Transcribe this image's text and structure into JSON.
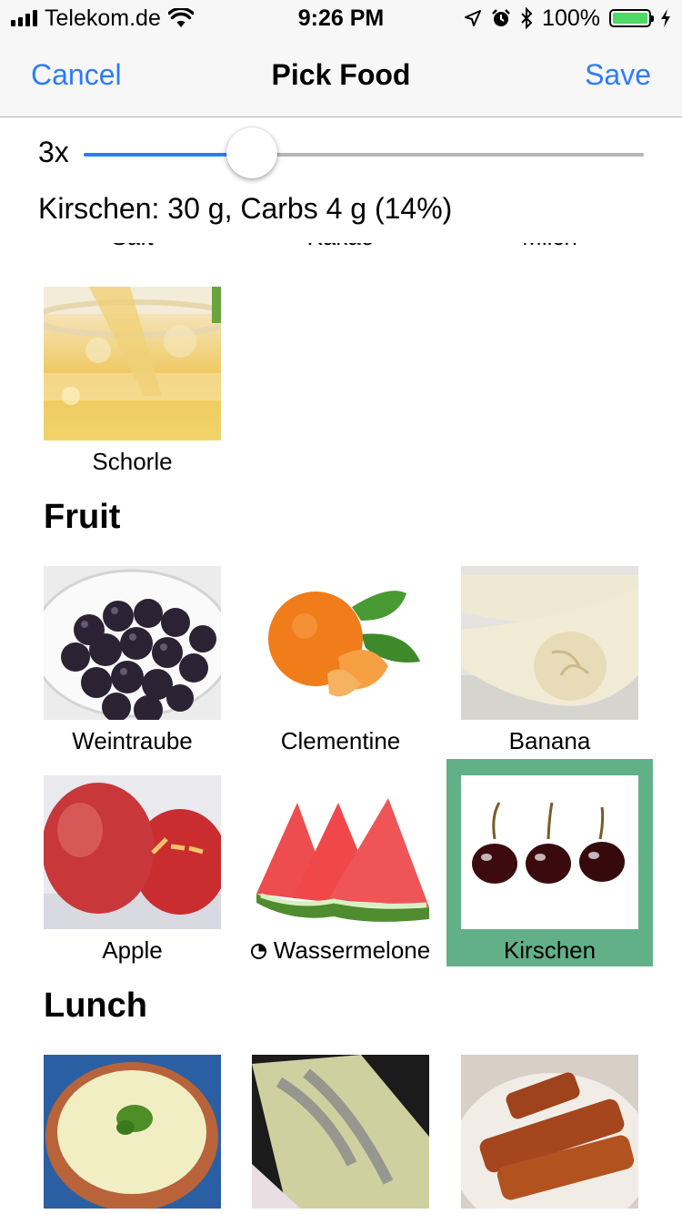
{
  "status_bar": {
    "carrier": "Telekom.de",
    "time": "9:26 PM",
    "battery": "100%",
    "icons": [
      "signal-icon",
      "wifi-icon",
      "location-icon",
      "alarm-icon",
      "bluetooth-icon",
      "battery-icon",
      "charging-icon"
    ]
  },
  "nav": {
    "cancel": "Cancel",
    "title": "Pick Food",
    "save": "Save"
  },
  "slider": {
    "multiplier_label": "3x",
    "level_fraction": 0.3
  },
  "selection_info": "Kirschen: 30 g, Carbs 4 g (14%)",
  "drinks": {
    "partial_labels": [
      "Saft",
      "Kakao",
      "Milch"
    ],
    "items": [
      {
        "name": "Schorle"
      }
    ]
  },
  "sections": {
    "fruit": "Fruit",
    "lunch": "Lunch"
  },
  "fruit_items": [
    {
      "name": "Weintraube"
    },
    {
      "name": "Clementine"
    },
    {
      "name": "Banana"
    },
    {
      "name": "Apple"
    },
    {
      "name": "Wassermelone"
    },
    {
      "name": "Kirschen"
    }
  ],
  "colors": {
    "accent": "#2d7cf6",
    "selected": "#62b088",
    "battery": "#4cd964"
  }
}
